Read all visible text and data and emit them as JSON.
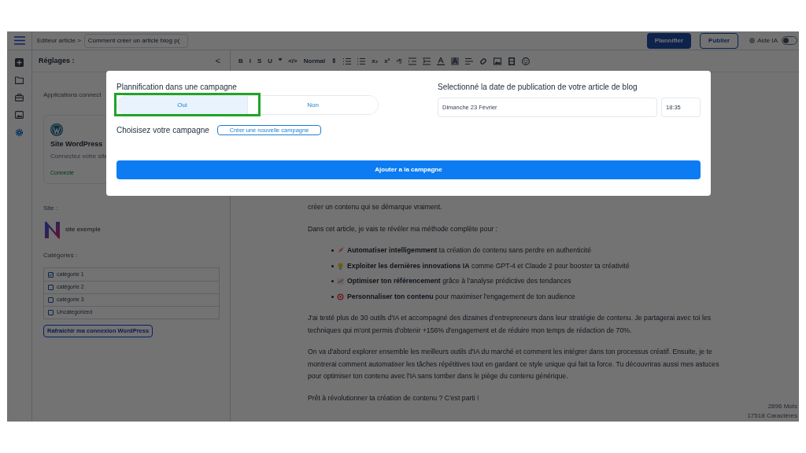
{
  "topbar": {
    "breadcrumb": "Editeur article >",
    "article_title": "Comment créer un article blog p(",
    "buttons": [
      {
        "label": "Plannifier",
        "kind": "primary"
      },
      {
        "label": "Publier",
        "kind": "outline"
      }
    ],
    "ai_help": {
      "label": "Aide IA",
      "on": false
    }
  },
  "sidebar": {
    "title": "Réglages :",
    "collapse": "<",
    "apps_label": "Applications connect",
    "wordpress_card": {
      "title": "Site WordPress",
      "description": "Connectez votre site",
      "status": "Connecté"
    },
    "site_label": "Site :",
    "site_name": "site exemple",
    "categories_label": "Catégories :",
    "categories": [
      {
        "label": "catégorie 1",
        "checked": true
      },
      {
        "label": "catégorie 2",
        "checked": false
      },
      {
        "label": "catégorie 3",
        "checked": false
      },
      {
        "label": "Uncategorized",
        "checked": false
      }
    ],
    "refresh_button": "Rafraichir ma connexion WordPress"
  },
  "toolbar": [
    {
      "kind": "glyph",
      "label": "B"
    },
    {
      "kind": "glyph",
      "label": "I"
    },
    {
      "kind": "glyph",
      "label": "S"
    },
    {
      "kind": "glyph",
      "label": "U"
    },
    {
      "kind": "glyph",
      "label": "❞"
    },
    {
      "kind": "glyph",
      "label": "</>"
    },
    {
      "kind": "glyph",
      "label": "Normal"
    },
    {
      "kind": "glyph",
      "label": "⇕"
    },
    {
      "kind": "ordered-list"
    },
    {
      "kind": "bullet-list"
    },
    {
      "kind": "glyph",
      "label": "x₂"
    },
    {
      "kind": "glyph",
      "label": "x²"
    },
    {
      "kind": "glyph",
      "label": "›¶"
    },
    {
      "kind": "outdent"
    },
    {
      "kind": "indent"
    },
    {
      "kind": "text-color"
    },
    {
      "kind": "highlight"
    },
    {
      "kind": "align"
    },
    {
      "kind": "link"
    },
    {
      "kind": "image"
    },
    {
      "kind": "video"
    },
    {
      "kind": "emoji"
    }
  ],
  "editor": {
    "blocks": [
      {
        "kind": "paragraph",
        "text": "créer un contenu qui se démarque vraiment."
      },
      {
        "kind": "paragraph",
        "text": "Dans cet article, je vais te révéler ma méthode complète pour :"
      },
      {
        "kind": "list",
        "items": [
          "**Automatiser intelligemment** ta création de contenu sans perdre en authenticité",
          "**Exploiter les dernières innovations IA** comme GPT-4 et Claude 2 pour booster ta créativité",
          "**Optimiser ton référencement** grâce à l'analyse prédictive des tendances",
          "**Personnaliser ton contenu** pour maximiser l'engagement de ton audience"
        ]
      },
      {
        "kind": "paragraph",
        "text": "J'ai testé plus de 30 outils d'IA et accompagné des dizaines d'entrepreneurs dans leur stratégie de contenu. Je partagerai avec toi les techniques qui m'ont permis d'obtenir +156% d'engagement et de réduire mon temps de rédaction de 70%."
      },
      {
        "kind": "paragraph",
        "text": "On va d'abord explorer ensemble les meilleurs outils d'IA du marché et comment les intégrer dans ton processus créatif. Ensuite, je te montrerai comment automatiser les tâches répétitives tout en gardant ce style unique qui fait ta force. Tu découvriras aussi mes astuces pour optimiser ton contenu avec l'IA sans tomber dans le piège du contenu générique."
      },
      {
        "kind": "paragraph",
        "text": "Prêt à révolutionner ta création de contenu ? C'est parti !"
      }
    ],
    "word_count": "2896 Mots",
    "char_count": "17518 Caractères"
  },
  "modal": {
    "campaign_title": "Plannification dans une campagne",
    "options": [
      {
        "label": "Oui",
        "selected": true
      },
      {
        "label": "Non",
        "selected": false
      }
    ],
    "choose_label": "Choisisez votre campagne",
    "new_campaign_button": "Créer une nouvelle campagne",
    "date_title": "Selectionné la date de publication de votre article de blog",
    "date_value": "Dimanche 23 Février",
    "time_value": "18:35",
    "submit_button": "Ajouter a la campagne"
  }
}
